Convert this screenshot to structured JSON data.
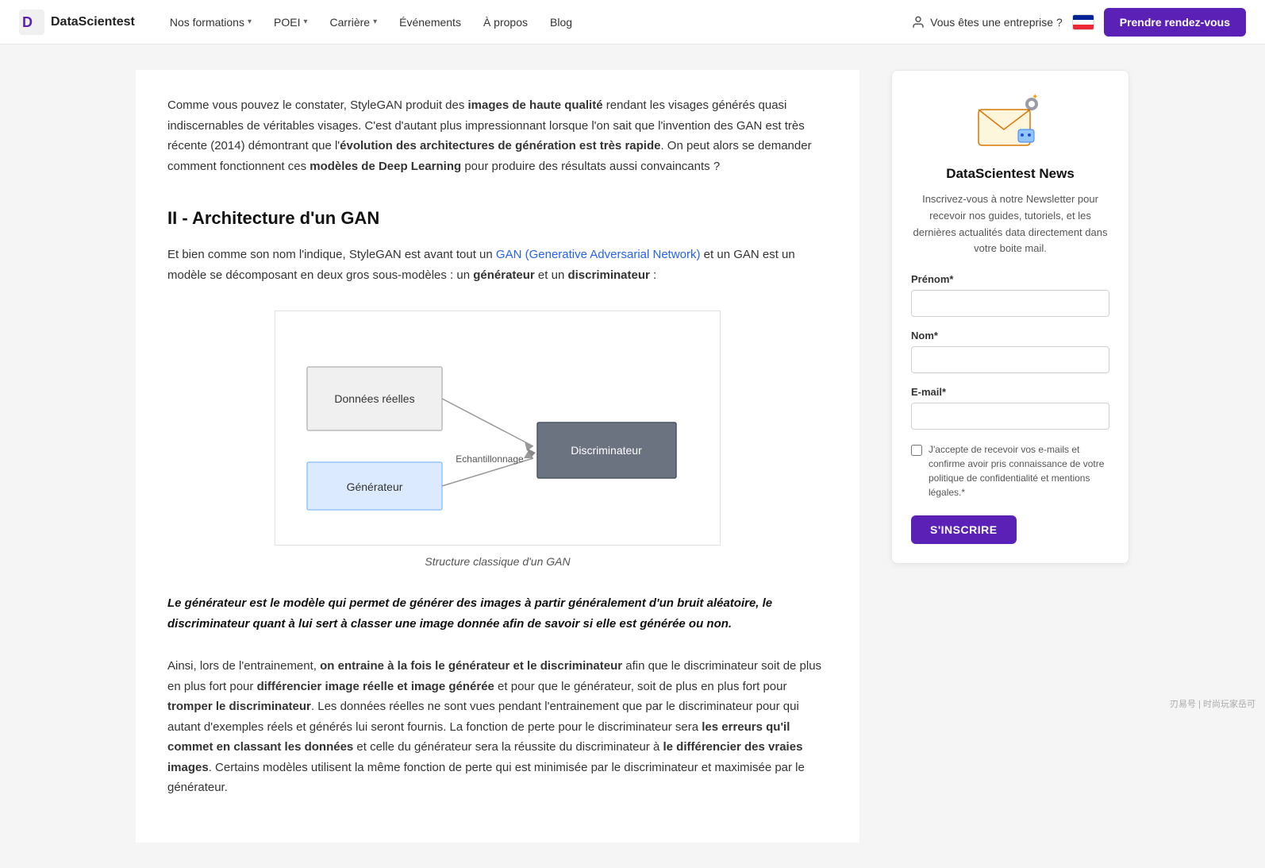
{
  "nav": {
    "logo_text": "DataScientest",
    "links": [
      {
        "label": "Nos formations",
        "has_dropdown": true
      },
      {
        "label": "POEI",
        "has_dropdown": true
      },
      {
        "label": "Carrière",
        "has_dropdown": true
      },
      {
        "label": "Événements",
        "has_dropdown": false
      },
      {
        "label": "À propos",
        "has_dropdown": false
      },
      {
        "label": "Blog",
        "has_dropdown": false
      }
    ],
    "enterprise_label": "Vous êtes une entreprise ?",
    "cta_label": "Prendre rendez-vous"
  },
  "main": {
    "intro_paragraph": "Comme vous pouvez le constater, StyleGAN produit des images de haute qualité rendant les visages générés quasi indiscernables de véritables visages. C'est d'autant plus impressionnant lorsque l'on sait que l'invention des GAN est très récente (2014) démontrant que l'évolution des architectures de génération est très rapide. On peut alors se demander comment fonctionnent ces modèles de Deep Learning pour produire des résultats aussi convaincants ?",
    "section_heading": "II - Architecture d'un GAN",
    "section_paragraph1_start": "Et bien comme son nom l'indique, StyleGAN est avant tout un ",
    "section_paragraph1_link": "GAN (Generative Adversarial Network)",
    "section_paragraph1_end": " et un GAN est un modèle se décomposant en deux gros sous-modèles : un générateur et un discriminateur :",
    "diagram_caption": "Structure classique d'un GAN",
    "diagram": {
      "box1_label": "Données réelles",
      "box2_label": "Générateur",
      "box3_label": "Discriminateur",
      "arrow_label": "Echantillonnage"
    },
    "blockquote": "Le générateur est le modèle qui permet de générer des images à partir généralement d'un bruit aléatoire, le discriminateur quant à lui sert à classer une image donnée afin de savoir si elle est générée ou non.",
    "conclusion_para": "Ainsi, lors de l'entrainement, on entraine à la fois le générateur et le discriminateur afin que le discriminateur soit de plus en plus fort pour différencier image réelle et image générée et pour que le générateur, soit de plus en plus fort pour tromper le discriminateur. Les données réelles ne sont vues pendant l'entrainement que par le discriminateur pour qui autant d'exemples réels et générés lui seront fournis. La fonction de perte pour le discriminateur sera les erreurs qu'il commet en classant les données et celle du générateur sera la réussite du discriminateur à le différencier des vraies images. Certains modèles utilisent la même fonction de perte qui est minimisée par le discriminateur et maximisée par le générateur."
  },
  "sidebar": {
    "newsletter": {
      "title": "DataScientest News",
      "description": "Inscrivez-vous à notre Newsletter pour recevoir nos guides, tutoriels, et les dernières actualités data directement dans votre boite mail.",
      "prenom_label": "Prénom*",
      "prenom_placeholder": "",
      "nom_label": "Nom*",
      "nom_placeholder": "",
      "email_label": "E-mail*",
      "email_placeholder": "",
      "checkbox_text": "J'accepte de recevoir vos e-mails et confirme avoir pris connaissance de votre politique de confidentialité et mentions légales.*",
      "submit_label": "S'INSCRIRE"
    }
  },
  "watermark": "刃易号 | 时尚玩家岳可"
}
